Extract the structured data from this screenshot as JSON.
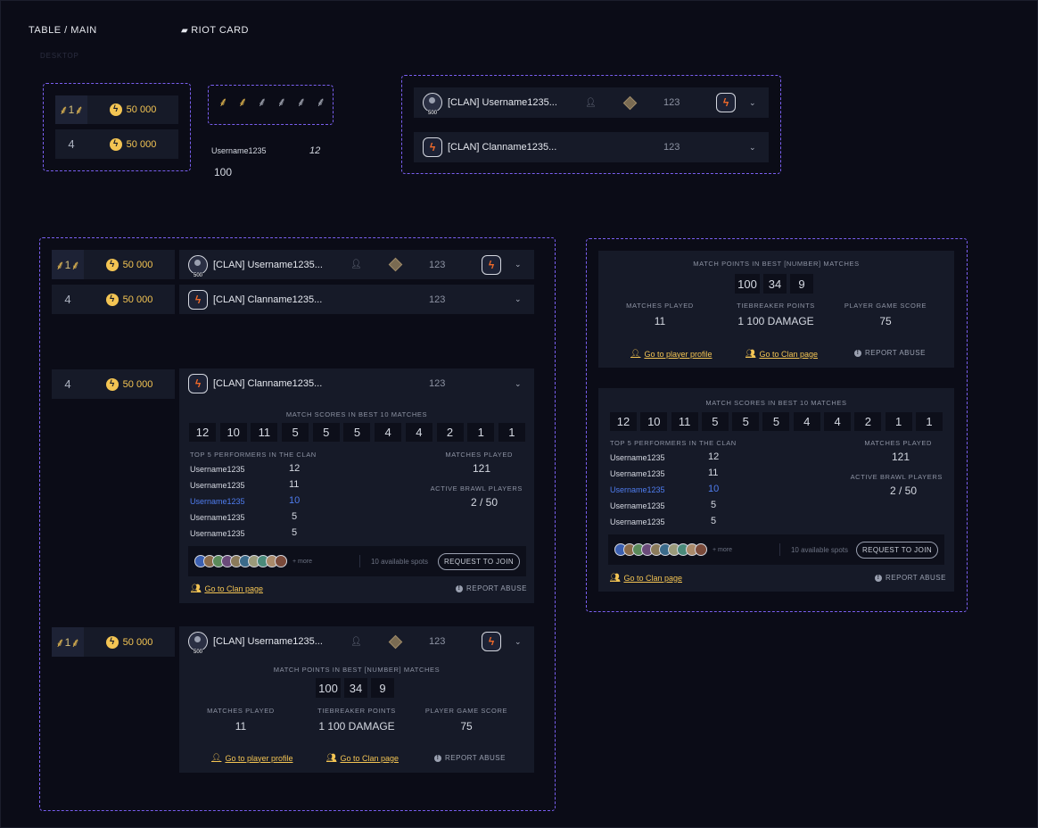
{
  "header": {
    "title": "TABLE / MAIN",
    "component": "RIOT CARD",
    "breakpoint": "DESKTOP"
  },
  "colors": {
    "accent": "#f3c453",
    "frame": "#7a5ff0",
    "highlight": "#4f7df0",
    "clan": "#f26a2a"
  },
  "ranks": {
    "first": "1",
    "fourth": "4"
  },
  "prize": "50 000",
  "avatar_level": "500",
  "clan_logo": "ϟ",
  "user": {
    "name": "[CLAN] Username1235...",
    "score": "123"
  },
  "clan": {
    "name": "[CLAN] Clanname1235...",
    "score": "123"
  },
  "sample": {
    "username": "Username1235",
    "score": "12",
    "value": "100"
  },
  "icons": {
    "chevron": "chevron-down-icon",
    "bolt": "bolt-icon",
    "laurel": "laurel-icon",
    "friend": "add-friend-icon",
    "rank": "rank-diamond-icon",
    "info": "info-icon"
  },
  "player_details": {
    "match_points_title": "MATCH POINTS IN BEST [NUMBER] MATCHES",
    "points": [
      "100",
      "34",
      "9"
    ],
    "matches_played_label": "MATCHES PLAYED",
    "matches_played": "11",
    "tiebreaker_label": "TIEBREAKER POINTS",
    "tiebreaker": "1 100 DAMAGE",
    "game_score_label": "PLAYER GAME SCORE",
    "game_score": "75",
    "player_link": "Go to player profile",
    "clan_link": "Go to Clan page",
    "report": "REPORT ABUSE"
  },
  "clan_details": {
    "scores_title": "MATCH SCORES IN BEST 10 MATCHES",
    "scores": [
      "12",
      "10",
      "11",
      "5",
      "5",
      "5",
      "4",
      "4",
      "2",
      "1",
      "1"
    ],
    "performers_title": "TOP 5 PERFORMERS IN THE CLAN",
    "performers": [
      {
        "name": "Username1235",
        "score": "12"
      },
      {
        "name": "Username1235",
        "score": "11"
      },
      {
        "name": "Username1235",
        "score": "10"
      },
      {
        "name": "Username1235",
        "score": "5"
      },
      {
        "name": "Username1235",
        "score": "5"
      }
    ],
    "matches_played_label": "MATCHES PLAYED",
    "matches_played": "121",
    "active_label": "ACTIVE BRAWL PLAYERS",
    "active": "2 / 50",
    "more": "+ more",
    "spots": "10 available spots",
    "join": "REQUEST TO JOIN",
    "clan_link": "Go to Clan page",
    "report": "REPORT ABUSE"
  }
}
